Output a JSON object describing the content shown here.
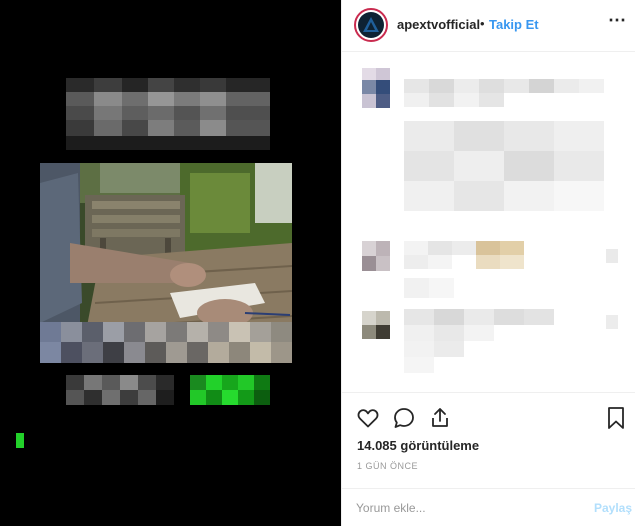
{
  "post": {
    "username": "apextvofficial",
    "separator": "•",
    "follow_label": "Takip Et",
    "more_icon": "⋯",
    "views_text": "14.085 görüntüleme",
    "time_text": "1 GÜN ÖNCE",
    "comment_placeholder": "Yorum ekle...",
    "share_label": "Paylaş"
  },
  "icons": {
    "avatar": "apex-logo-icon",
    "like": "heart-icon",
    "comment": "speech-bubble-icon",
    "share": "share-upload-icon",
    "save": "bookmark-icon"
  },
  "colors": {
    "accent": "#3897f0",
    "avatar_ring": "#c92b4f",
    "media_background": "#000000",
    "caption_highlight": "#22d12a",
    "share_disabled": "#b2dffc"
  }
}
